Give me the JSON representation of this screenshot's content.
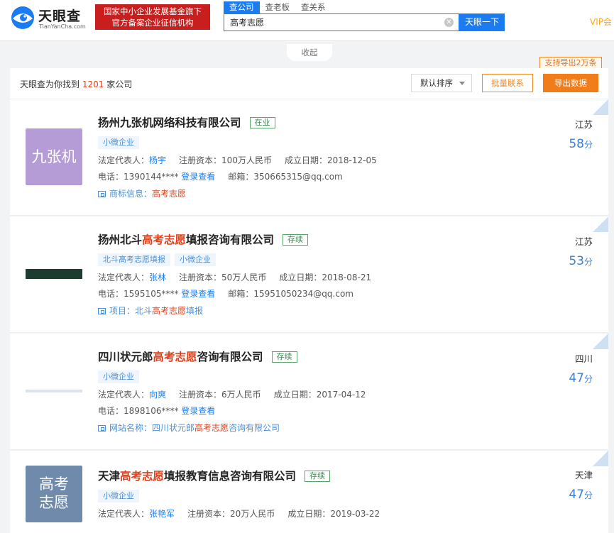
{
  "brand": {
    "name_cn": "天眼查",
    "name_en": "TianYanCha.com",
    "badge_line1": "国家中小企业发展基金旗下",
    "badge_line2": "官方备案企业征信机构"
  },
  "search": {
    "tabs": [
      "查公司",
      "查老板",
      "查关系"
    ],
    "active_tab": "查公司",
    "query": "高考志愿",
    "button_label": "天眼一下"
  },
  "header": {
    "vip_label": "VIP会"
  },
  "collapse_label": "收起",
  "results": {
    "prefix": "天眼查为你找到",
    "count": "1201",
    "suffix": "家公司",
    "sort_label": "默认排序",
    "batch_label": "批量联系",
    "export_label": "导出数据",
    "export_tip": "支持导出2万条"
  },
  "companies": [
    {
      "logo_text": "九张机",
      "name_pre": "扬州九张机网络科技有限公司",
      "name_hl": "",
      "name_post": "",
      "status": "在业",
      "tags": [
        "小微企业"
      ],
      "rep_label": "法定代表人：",
      "rep": "杨宇",
      "capital_label": "注册资本：",
      "capital": "100万人民币",
      "date_label": "成立日期：",
      "date": "2018-12-05",
      "phone_label": "电话：",
      "phone": "1390144****",
      "login_link": "登录查看",
      "email_label": "邮箱：",
      "email": "350665315@qq.com",
      "match_label": "商标信息：",
      "match_pre": "",
      "match_hl": "高考志愿",
      "match_post": "",
      "province": "江苏",
      "score": "58",
      "score_unit": "分"
    },
    {
      "logo_text": "",
      "name_pre": "扬州北斗",
      "name_hl": "高考志愿",
      "name_post": "填报咨询有限公司",
      "status": "存续",
      "tags": [
        "北斗高考志愿填报",
        "小微企业"
      ],
      "rep_label": "法定代表人：",
      "rep": "张林",
      "capital_label": "注册资本：",
      "capital": "50万人民币",
      "date_label": "成立日期：",
      "date": "2018-08-21",
      "phone_label": "电话：",
      "phone": "1595105****",
      "login_link": "登录查看",
      "email_label": "邮箱：",
      "email": "15951050234@qq.com",
      "match_label": "项目：",
      "match_pre": "北斗",
      "match_hl": "高考志愿",
      "match_post": "填报",
      "province": "江苏",
      "score": "53",
      "score_unit": "分"
    },
    {
      "logo_text": "",
      "name_pre": "四川状元郎",
      "name_hl": "高考志愿",
      "name_post": "咨询有限公司",
      "status": "存续",
      "tags": [
        "小微企业"
      ],
      "rep_label": "法定代表人：",
      "rep": "向爽",
      "capital_label": "注册资本：",
      "capital": "6万人民币",
      "date_label": "成立日期：",
      "date": "2017-04-12",
      "phone_label": "电话：",
      "phone": "1898106****",
      "login_link": "登录查看",
      "email_label": "",
      "email": "",
      "match_label": "网站名称：",
      "match_pre": "四川状元郎",
      "match_hl": "高考志愿",
      "match_post": "咨询有限公司",
      "province": "四川",
      "score": "47",
      "score_unit": "分"
    },
    {
      "logo_text": "高考志愿",
      "logo_line1": "高考",
      "logo_line2": "志愿",
      "name_pre": "天津",
      "name_hl": "高考志愿",
      "name_post": "填报教育信息咨询有限公司",
      "status": "存续",
      "tags": [
        "小微企业"
      ],
      "rep_label": "法定代表人：",
      "rep": "张艳军",
      "capital_label": "注册资本：",
      "capital": "20万人民币",
      "date_label": "成立日期：",
      "date": "2019-03-22",
      "province": "天津",
      "score": "47",
      "score_unit": "分"
    }
  ]
}
